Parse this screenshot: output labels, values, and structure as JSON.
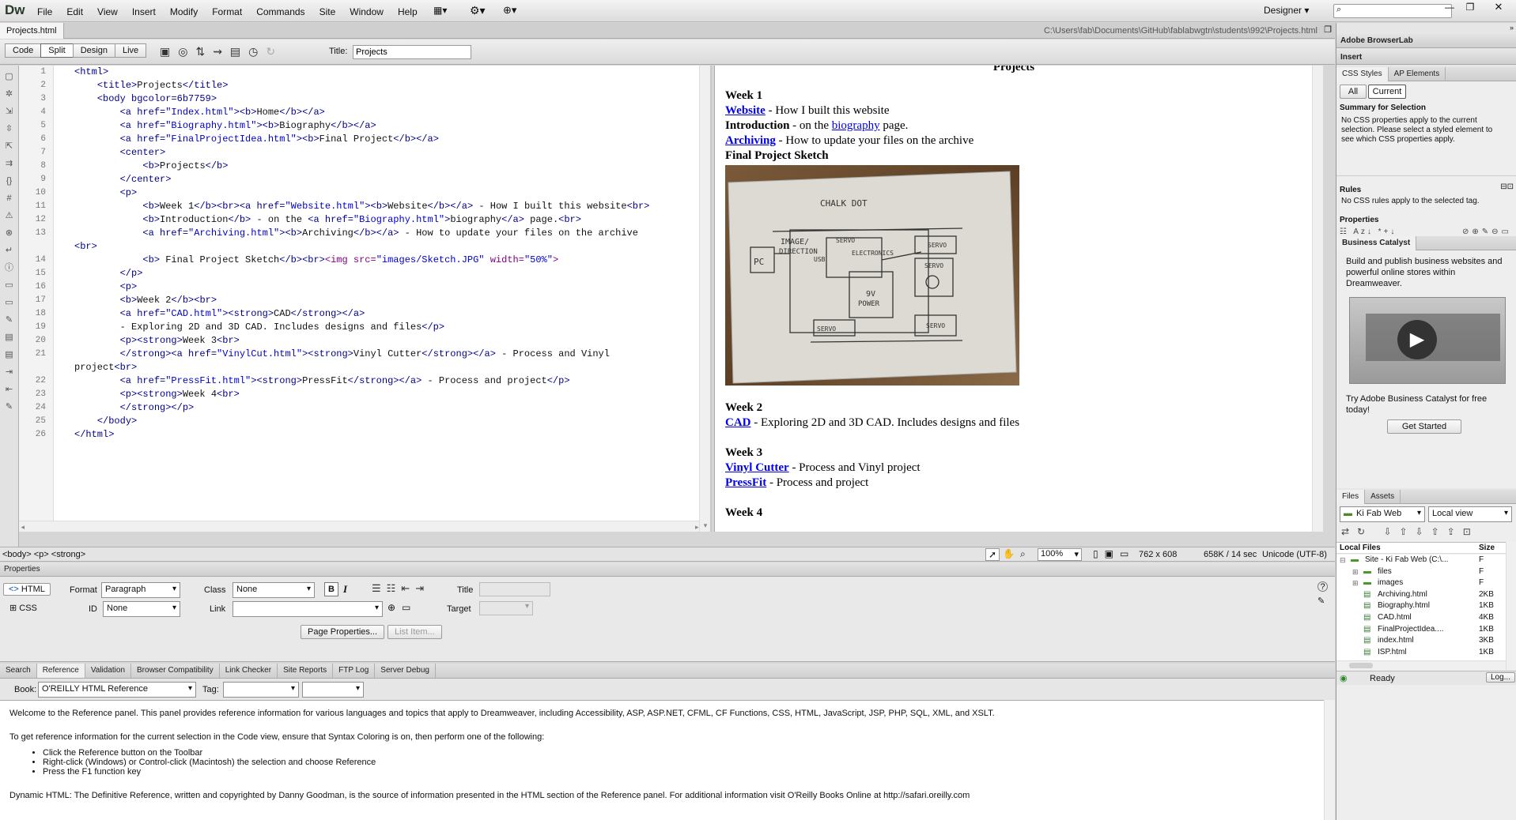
{
  "app": {
    "logo": "Dw",
    "workspace": "Designer",
    "search_placeholder": ""
  },
  "menu": [
    "File",
    "Edit",
    "View",
    "Insert",
    "Modify",
    "Format",
    "Commands",
    "Site",
    "Window",
    "Help"
  ],
  "doc_tab": {
    "name": "Projects.html",
    "path": "C:\\Users\\fab\\Documents\\GitHub\\fablabwgtn\\students\\992\\Projects.html"
  },
  "doc_toolbar": {
    "views": [
      "Code",
      "Split",
      "Design",
      "Live"
    ],
    "title_label": "Title:",
    "title_value": "Projects"
  },
  "code_lines": [
    {
      "n": "1",
      "html": "<span class='tag'>&lt;html&gt;</span>"
    },
    {
      "n": "2",
      "html": "    <span class='tag'>&lt;title&gt;</span>Projects<span class='tag'>&lt;/title&gt;</span>"
    },
    {
      "n": "3",
      "html": "    <span class='tag'>&lt;body bgcolor=6b7759&gt;</span>"
    },
    {
      "n": "4",
      "html": "        <span class='tag'>&lt;a href=</span><span class='str'>\"Index.html\"</span><span class='tag'>&gt;&lt;b&gt;</span>Home<span class='tag'>&lt;/b&gt;&lt;/a&gt;</span>"
    },
    {
      "n": "5",
      "html": "        <span class='tag'>&lt;a href=</span><span class='str'>\"Biography.html\"</span><span class='tag'>&gt;&lt;b&gt;</span>Biography<span class='tag'>&lt;/b&gt;&lt;/a&gt;</span>"
    },
    {
      "n": "6",
      "html": "        <span class='tag'>&lt;a href=</span><span class='str'>\"FinalProjectIdea.html\"</span><span class='tag'>&gt;&lt;b&gt;</span>Final Project<span class='tag'>&lt;/b&gt;&lt;/a&gt;</span>"
    },
    {
      "n": "7",
      "html": "        <span class='tag'>&lt;center&gt;</span>"
    },
    {
      "n": "8",
      "html": "            <span class='tag'>&lt;b&gt;</span>Projects<span class='tag'>&lt;/b&gt;</span>"
    },
    {
      "n": "9",
      "html": "        <span class='tag'>&lt;/center&gt;</span>"
    },
    {
      "n": "10",
      "html": "        <span class='tag'>&lt;p&gt;</span>"
    },
    {
      "n": "11",
      "html": "            <span class='tag'>&lt;b&gt;</span>Week 1<span class='tag'>&lt;/b&gt;&lt;br&gt;&lt;a href=</span><span class='str'>\"Website.html\"</span><span class='tag'>&gt;&lt;b&gt;</span>Website<span class='tag'>&lt;/b&gt;&lt;/a&gt;</span> - How I built this website<span class='tag'>&lt;br&gt;</span>"
    },
    {
      "n": "12",
      "html": "            <span class='tag'>&lt;b&gt;</span>Introduction<span class='tag'>&lt;/b&gt;</span> - on the <span class='tag'>&lt;a href=</span><span class='str'>\"Biography.html\"</span><span class='tag'>&gt;</span>biography<span class='tag'>&lt;/a&gt;</span> page.<span class='tag'>&lt;br&gt;</span>"
    },
    {
      "n": "13",
      "html": "            <span class='tag'>&lt;a href=</span><span class='str'>\"Archiving.html\"</span><span class='tag'>&gt;&lt;b&gt;</span>Archiving<span class='tag'>&lt;/b&gt;&lt;/a&gt;</span> - How to update your files on the archive"
    },
    {
      "n": "",
      "html": "<span class='tag'>&lt;br&gt;</span>"
    },
    {
      "n": "14",
      "html": "            <span class='tag'>&lt;b&gt;</span> Final Project Sketch<span class='tag'>&lt;/b&gt;&lt;br&gt;</span><span class='img'>&lt;img src=</span><span class='str'>\"images/Sketch.JPG\"</span><span class='img'> width=</span><span class='str'>\"50%\"</span><span class='img'>&gt;</span>"
    },
    {
      "n": "15",
      "html": "        <span class='tag'>&lt;/p&gt;</span>"
    },
    {
      "n": "16",
      "html": "        <span class='tag'>&lt;p&gt;</span>"
    },
    {
      "n": "17",
      "html": "        <span class='tag'>&lt;b&gt;</span>Week 2<span class='tag'>&lt;/b&gt;&lt;br&gt;</span>"
    },
    {
      "n": "18",
      "html": "        <span class='tag'>&lt;a href=</span><span class='str'>\"CAD.html\"</span><span class='tag'>&gt;&lt;strong&gt;</span>CAD<span class='tag'>&lt;/strong&gt;&lt;/a&gt;</span>"
    },
    {
      "n": "19",
      "html": "        - Exploring 2D and 3D CAD. Includes designs and files<span class='tag'>&lt;/p&gt;</span>"
    },
    {
      "n": "20",
      "html": "        <span class='tag'>&lt;p&gt;&lt;strong&gt;</span>Week 3<span class='tag'>&lt;br&gt;</span>"
    },
    {
      "n": "21",
      "html": "        <span class='tag'>&lt;/strong&gt;&lt;a href=</span><span class='str'>\"VinylCut.html\"</span><span class='tag'>&gt;&lt;strong&gt;</span>Vinyl Cutter<span class='tag'>&lt;/strong&gt;&lt;/a&gt;</span> - Process and Vinyl"
    },
    {
      "n": "",
      "html": "project<span class='tag'>&lt;br&gt;</span>"
    },
    {
      "n": "22",
      "html": "        <span class='tag'>&lt;a href=</span><span class='str'>\"PressFit.html\"</span><span class='tag'>&gt;&lt;strong&gt;</span>PressFit<span class='tag'>&lt;/strong&gt;&lt;/a&gt;</span> - Process and project<span class='tag'>&lt;/p&gt;</span>"
    },
    {
      "n": "23",
      "html": "        <span class='tag'>&lt;p&gt;&lt;strong&gt;</span>Week 4<span class='tag'>&lt;br&gt;</span>"
    },
    {
      "n": "24",
      "html": "        <span class='tag'>&lt;/strong&gt;&lt;/p&gt;</span>"
    },
    {
      "n": "25",
      "html": "    <span class='tag'>&lt;/body&gt;</span>"
    },
    {
      "n": "26",
      "html": "<span class='tag'>&lt;/html&gt;</span>"
    }
  ],
  "design": {
    "heading": "Projects",
    "week1": "Week 1",
    "website_link": "Website",
    "website_text": " - How I built this website",
    "intro_bold": "Introduction",
    "intro_text1": " - on the ",
    "bio_link": "biography",
    "intro_text2": " page.",
    "archiving_link": "Archiving",
    "archiving_text": " - How to update your files on the archive",
    "sketch_title": "Final Project Sketch",
    "week2": "Week 2",
    "cad_link": "CAD",
    "cad_text": " - Exploring 2D and 3D CAD. Includes designs and files",
    "week3": "Week 3",
    "vinyl_link": "Vinyl Cutter",
    "vinyl_text": " - Process and Vinyl project",
    "pressfit_link": "PressFit",
    "pressfit_text": " - Process and project",
    "week4": "Week 4",
    "sketch_labels": {
      "top": "CHALK DOT",
      "pc": "PC",
      "img": "IMAGE/",
      "dir": "DIRECTION",
      "usb": "USB",
      "servo1": "SERVO",
      "elec": "ELECTRONICS",
      "servo2": "SERVO",
      "servo3": "SERVO",
      "power1": "9V",
      "power2": "POWER",
      "servo4": "SERVO",
      "servo5": "SERVO"
    }
  },
  "status": {
    "tag_selector": "<body> <p> <strong>",
    "zoom": "100%",
    "dims": "762 x 608",
    "size": "658K / 14 sec",
    "encoding": "Unicode (UTF-8)"
  },
  "properties": {
    "title": "Properties",
    "html_btn": "HTML",
    "css_btn": "CSS",
    "format_label": "Format",
    "format_value": "Paragraph",
    "class_label": "Class",
    "class_value": "None",
    "id_label": "ID",
    "id_value": "None",
    "link_label": "Link",
    "link_value": "",
    "title_label": "Title",
    "target_label": "Target",
    "page_props": "Page Properties...",
    "list_item": "List Item..."
  },
  "results": {
    "tabs": [
      "Search",
      "Reference",
      "Validation",
      "Browser Compatibility",
      "Link Checker",
      "Site Reports",
      "FTP Log",
      "Server Debug"
    ],
    "book_label": "Book:",
    "book_value": "O'REILLY HTML Reference",
    "tag_label": "Tag:",
    "p1": "Welcome to the Reference panel. This panel provides reference information for various languages and topics that apply to Dreamweaver, including Accessibility, ASP, ASP.NET, CFML, CF Functions, CSS, HTML, JavaScript, JSP, PHP, SQL, XML, and XSLT.",
    "p2": "To get reference information for the current selection in the Code view, ensure that Syntax Coloring is on, then perform one of the following:",
    "bullets": [
      "Click the Reference button on the Toolbar",
      "Right-click (Windows) or Control-click (Macintosh) the selection and choose Reference",
      "Press the F1 function key"
    ],
    "p3": "Dynamic HTML: The Definitive Reference, written and copyrighted by Danny Goodman, is the source of information presented in the HTML section of the Reference panel. For additional information visit O'Reilly Books Online at http://safari.oreilly.com"
  },
  "right": {
    "browserlab": "Adobe BrowserLab",
    "insert": "Insert",
    "css_tabs": [
      "CSS Styles",
      "AP Elements"
    ],
    "all_btn": "All",
    "current_btn": "Current",
    "summary_title": "Summary for Selection",
    "summary_text": "No CSS properties apply to the current selection.  Please select a styled element to see which CSS properties apply.",
    "rules_title": "Rules",
    "rules_text": "No CSS rules apply to the selected tag.",
    "props_title": "Properties",
    "bc_tab": "Business Catalyst",
    "bc_text": "Build and publish business websites and powerful online stores within Dreamweaver.",
    "bc_try": "Try Adobe Business Catalyst for free today!",
    "bc_btn": "Get Started",
    "files_tabs": [
      "Files",
      "Assets"
    ],
    "site_value": "Ki Fab Web",
    "view_value": "Local view",
    "local_files": "Local Files",
    "size_col": "Size",
    "tree": [
      {
        "name": "Site - Ki Fab Web (C:\\...",
        "size": "F",
        "indent": 0,
        "kind": "site"
      },
      {
        "name": "files",
        "size": "F",
        "indent": 1,
        "kind": "folder"
      },
      {
        "name": "images",
        "size": "F",
        "indent": 1,
        "kind": "folder"
      },
      {
        "name": "Archiving.html",
        "size": "2KB",
        "indent": 1,
        "kind": "file"
      },
      {
        "name": "Biography.html",
        "size": "1KB",
        "indent": 1,
        "kind": "file"
      },
      {
        "name": "CAD.html",
        "size": "4KB",
        "indent": 1,
        "kind": "file"
      },
      {
        "name": "FinalProjectIdea....",
        "size": "1KB",
        "indent": 1,
        "kind": "file"
      },
      {
        "name": "index.html",
        "size": "3KB",
        "indent": 1,
        "kind": "file"
      },
      {
        "name": "ISP.html",
        "size": "1KB",
        "indent": 1,
        "kind": "file"
      }
    ],
    "ready": "Ready",
    "log_btn": "Log..."
  }
}
